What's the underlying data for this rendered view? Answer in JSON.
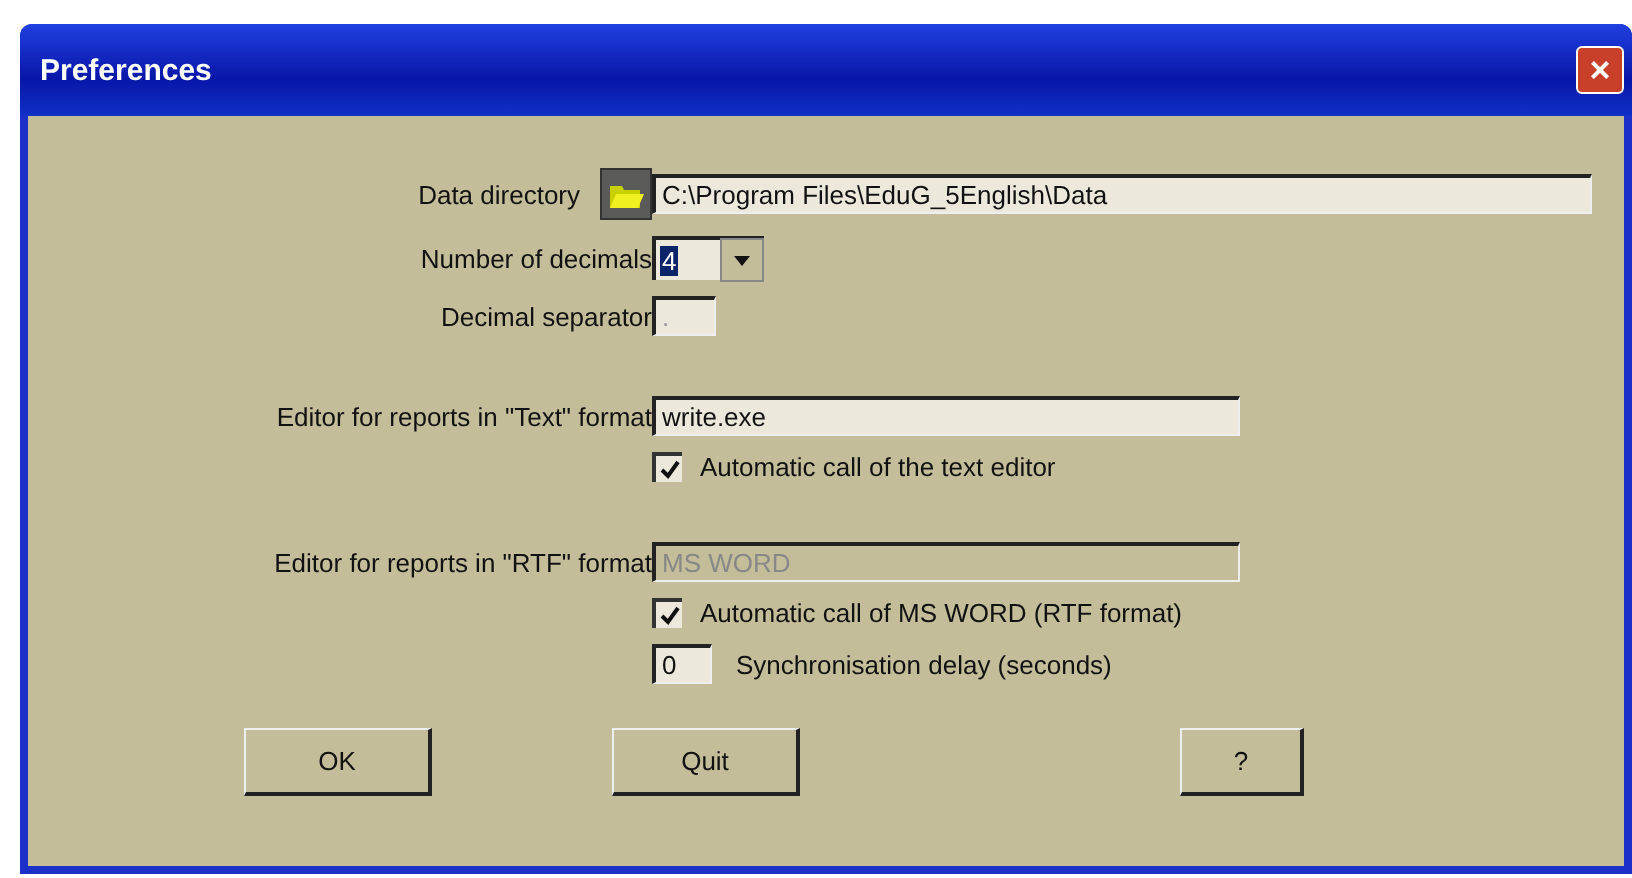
{
  "window": {
    "title": "Preferences",
    "close": "×"
  },
  "data_directory": {
    "label": "Data directory",
    "value": "C:\\Program Files\\EduG_5English\\Data"
  },
  "number_of_decimals": {
    "label": "Number of decimals",
    "value": "4",
    "selected": true
  },
  "decimal_separator": {
    "label": "Decimal separator",
    "value": "."
  },
  "text_editor": {
    "label": "Editor for reports in \"Text\" format",
    "value": "write.exe",
    "disabled": false
  },
  "text_auto": {
    "label": "Automatic call of the text editor",
    "checked": true
  },
  "rtf_editor": {
    "label": "Editor for reports in \"RTF\" format",
    "value": "MS WORD",
    "disabled": true
  },
  "rtf_auto": {
    "label": "Automatic call of MS WORD (RTF format)",
    "checked": true
  },
  "sync_delay": {
    "value": "0",
    "label": "Synchronisation delay (seconds)"
  },
  "buttons": [
    {
      "label": "OK"
    },
    {
      "label": "Quit"
    },
    {
      "label": "?"
    }
  ]
}
